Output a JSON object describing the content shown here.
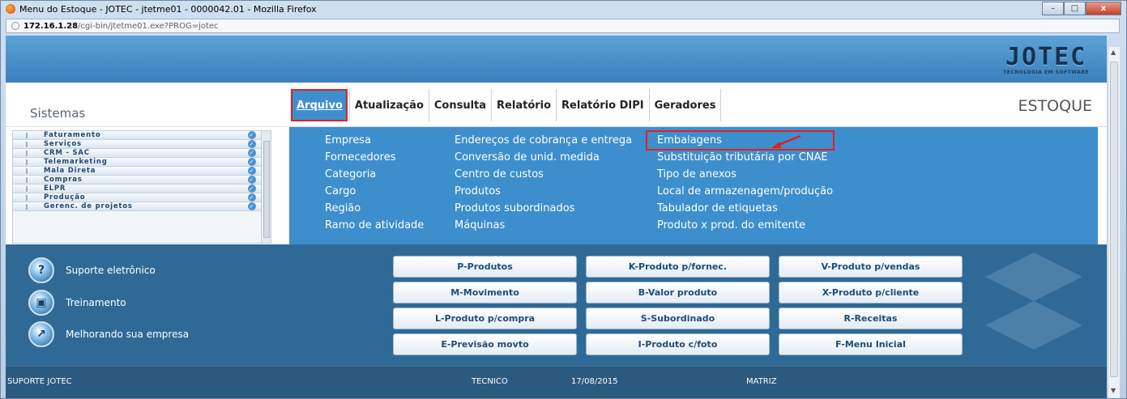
{
  "window": {
    "title": "Menu do Estoque - JOTEC - jtetme01 - 0000042.01 - Mozilla Firefox",
    "url_host": "172.16.1.28",
    "url_path": "/cgi-bin/jtetme01.exe?PROG=jotec",
    "minimize": "–",
    "maximize": "□",
    "close": "x"
  },
  "logo": {
    "text": "JOTEC",
    "tagline": "TECNOLOGIA EM SOFTWARE"
  },
  "header": {
    "sistemas": "Sistemas",
    "module": "ESTOQUE"
  },
  "menu": {
    "items": [
      {
        "label": "Arquivo"
      },
      {
        "label": "Atualização"
      },
      {
        "label": "Consulta"
      },
      {
        "label": "Relatório"
      },
      {
        "label": "Relatório DIPI"
      },
      {
        "label": "Geradores"
      }
    ]
  },
  "sidebar": {
    "items": [
      "Faturamento",
      "Serviços",
      "CRM - SAC",
      "Telemarketing",
      "Mala Direta",
      "Compras",
      "ELPR",
      "Produção",
      "Gerenc. de projetos"
    ]
  },
  "dropdown": {
    "col1": [
      "Empresa",
      "Fornecedores",
      "Categoria",
      "Cargo",
      "Região",
      "Ramo de atividade"
    ],
    "col2": [
      "Endereços de cobrança e entrega",
      "Conversão de unid. medida",
      "Centro de custos",
      "Produtos",
      "Produtos subordinados",
      "Máquinas"
    ],
    "col3": [
      "Embalagens",
      "Substituição tributária por CNAE",
      "Tipo de anexos",
      "Local de armazenagem/produção",
      "Tabulador de etiquetas",
      "Produto x prod. do emitente"
    ]
  },
  "links": {
    "suporte": "Suporte eletrônico",
    "treinamento": "Treinamento",
    "melhorando": "Melhorando sua empresa"
  },
  "buttons": {
    "b1": "P-Produtos",
    "b2": "K-Produto p/fornec.",
    "b3": "V-Produto p/vendas",
    "b4": "M-Movimento",
    "b5": "B-Valor produto",
    "b6": "X-Produto p/cliente",
    "b7": "L-Produto p/compra",
    "b8": "S-Subordinado",
    "b9": "R-Receitas",
    "b10": "E-Previsão movto",
    "b11": "I-Produto c/foto",
    "b12": "F-Menu Inicial"
  },
  "status": {
    "left": "SUPORTE JOTEC",
    "user": "TECNICO",
    "date": "17/08/2015",
    "branch": "MATRIZ"
  },
  "colors": {
    "menu_blue": "#3d8ecd",
    "highlight_red": "#e0201f",
    "bottom_panel": "#2f6a96"
  }
}
